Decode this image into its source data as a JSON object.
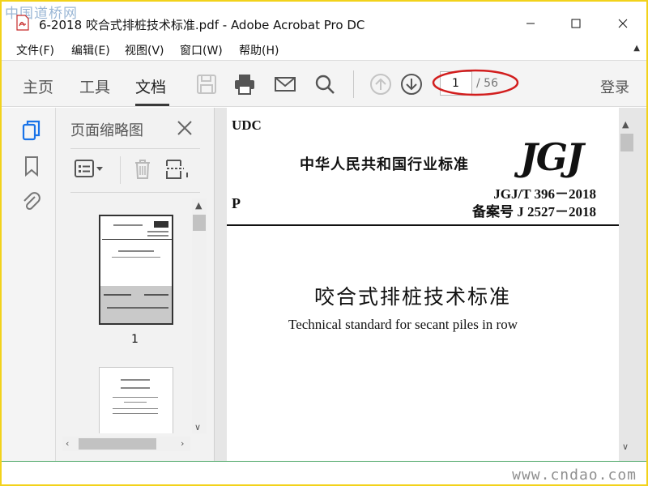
{
  "watermark_top": "中国道桥网",
  "window": {
    "title": "6-2018 咬合式排桩技术标准.pdf - Adobe Acrobat Pro DC",
    "icons": {
      "app": "pdf-icon",
      "minimize": "minimize-icon",
      "maximize": "maximize-icon",
      "close": "close-icon"
    }
  },
  "menu": {
    "items": [
      {
        "label": "文件(F)"
      },
      {
        "label": "编辑(E)"
      },
      {
        "label": "视图(V)"
      },
      {
        "label": "窗口(W)"
      },
      {
        "label": "帮助(H)"
      }
    ]
  },
  "toolbar": {
    "tabs": [
      {
        "label": "主页"
      },
      {
        "label": "工具"
      },
      {
        "label": "文档"
      }
    ],
    "active_tab": "文档",
    "icons": [
      "save-icon",
      "print-icon",
      "email-icon",
      "search-icon",
      "page-up-icon",
      "page-down-icon"
    ],
    "page_current": "1",
    "page_total": "/ 56",
    "login": "登录",
    "highlight_color": "#d21e1e"
  },
  "left_rail": {
    "icons": [
      "page-thumbnails-icon",
      "bookmark-icon",
      "attachment-icon"
    ],
    "active_color": "#1a73e8"
  },
  "thumbnails_pane": {
    "title": "页面缩略图",
    "tools": [
      "options-menu-icon",
      "delete-page-icon",
      "extract-page-icon"
    ],
    "items": [
      {
        "label": "1"
      }
    ]
  },
  "document": {
    "udc": "UDC",
    "std_category": "中华人民共和国行业标准",
    "logo": "JGJ",
    "p": "P",
    "std_number": "JGJ/T 396－2018",
    "record_number": "备案号 J 2527－2018",
    "title_cn": "咬合式排桩技术标准",
    "title_en": "Technical standard for secant piles in row"
  },
  "watermark_bottom": "www.cndao.com",
  "colors": {
    "frame": "#f2d21b",
    "status_line": "#4aa565"
  }
}
